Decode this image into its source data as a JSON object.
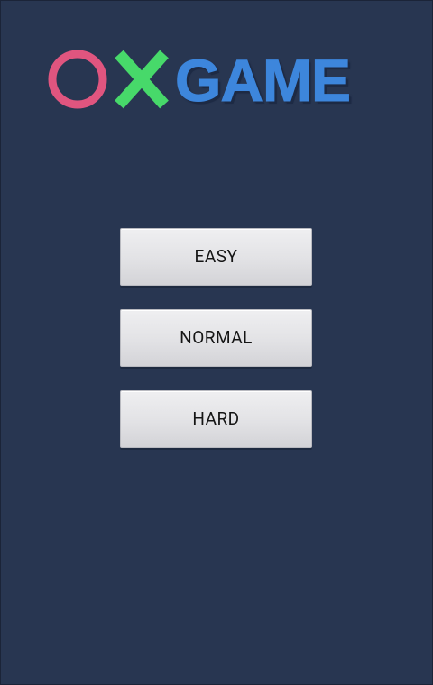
{
  "logo": {
    "o_symbol": "O",
    "x_symbol": "X",
    "word": "GAME",
    "o_color": "#e0557f",
    "x_color": "#47d96a",
    "word_color": "#3d86dc"
  },
  "menu": {
    "buttons": [
      {
        "label": "EASY"
      },
      {
        "label": "NORMAL"
      },
      {
        "label": "HARD"
      }
    ]
  },
  "theme": {
    "background": "#283651",
    "button_face": "#e2e2e5",
    "button_text": "#151515"
  }
}
